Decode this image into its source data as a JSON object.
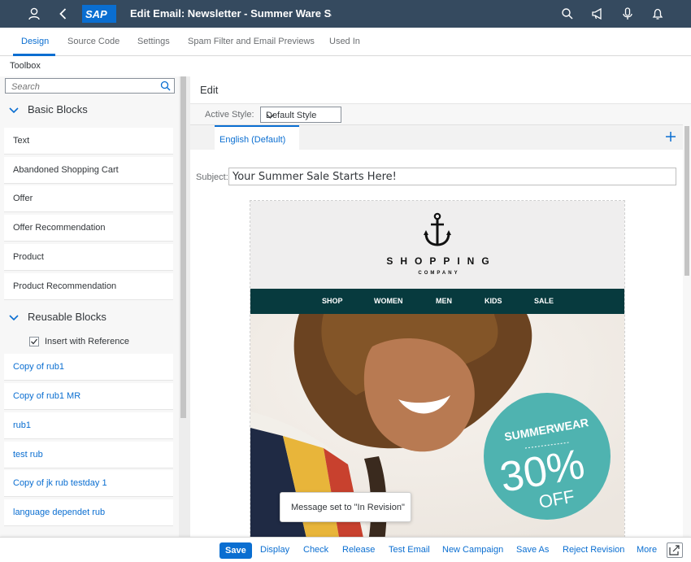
{
  "shell": {
    "title": "Edit Email: Newsletter - Summer Ware Sale",
    "logo_text": "SAP",
    "icons": [
      "user-icon",
      "back-icon",
      "search-icon",
      "megaphone-icon",
      "microphone-icon",
      "bell-icon"
    ]
  },
  "tabs": [
    "Design",
    "Source Code",
    "Settings",
    "Spam Filter and Email Previews",
    "Used In"
  ],
  "active_tab": "Design",
  "toolbox": {
    "label": "Toolbox",
    "search_placeholder": "Search",
    "basic_heading": "Basic Blocks",
    "basic_blocks": [
      "Text",
      "Abandoned Shopping Cart",
      "Offer",
      "Offer Recommendation",
      "Product",
      "Product Recommendation"
    ],
    "reusable_heading": "Reusable Blocks",
    "insert_with_reference": "Insert with Reference",
    "insert_checked": true,
    "reusable_blocks": [
      "Copy of rub1",
      "Copy of rub1 MR",
      "rub1",
      "test rub",
      "Copy of jk rub testday 1",
      "language dependet rub"
    ]
  },
  "editor": {
    "label": "Edit",
    "active_style_label": "Active Style:",
    "active_style_value": "Default Style",
    "language_tab": "English (Default)",
    "subject_label": "Subject:",
    "subject_value": "Your Summer Sale Starts Here!"
  },
  "email": {
    "brand": "SHOPPING",
    "brand_sub": "COMPANY",
    "nav": [
      "SHOP",
      "WOMEN",
      "MEN",
      "KIDS",
      "SALE"
    ],
    "badge_line1": "SUMMERWEAR",
    "badge_line2": "30%",
    "badge_line3": "OFF",
    "colors": {
      "nav_bg": "#073a3e",
      "badge": "#4fb3b0"
    }
  },
  "toast": "Message set to \"In Revision\"",
  "footer": {
    "buttons": [
      "Save",
      "Display",
      "Check",
      "Release",
      "Test Email",
      "New Campaign",
      "Save As",
      "Reject Revision",
      "More"
    ]
  },
  "colors": {
    "shell": "#354a5f",
    "accent": "#0a6ed1"
  }
}
